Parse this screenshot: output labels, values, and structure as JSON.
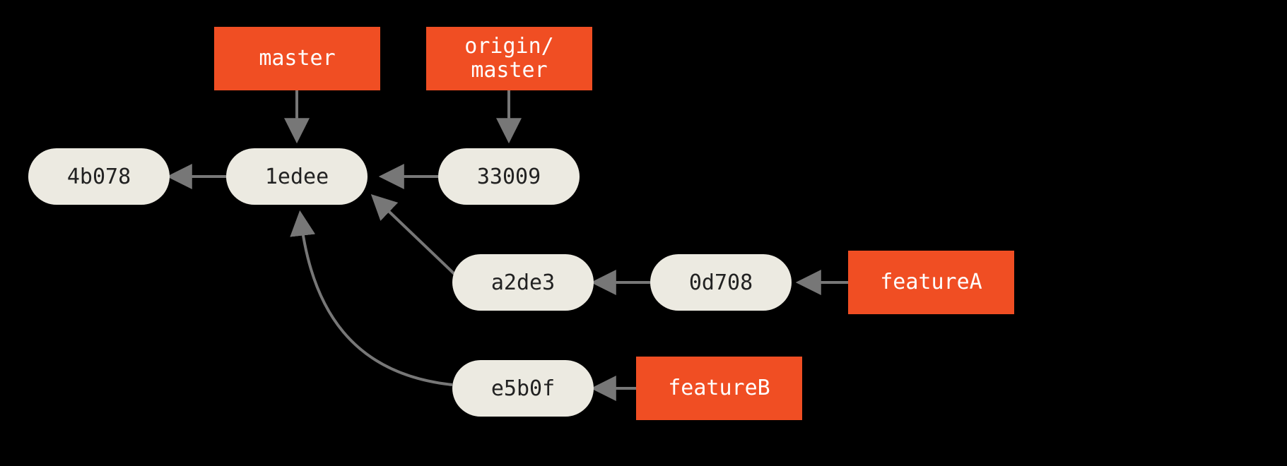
{
  "colors": {
    "bg": "#000000",
    "node_fill": "#ECEAE1",
    "node_text": "#222222",
    "branch_fill": "#F04E23",
    "branch_text": "#FFFFFF",
    "edge": "#777777"
  },
  "commits": {
    "c_4b078": "4b078",
    "c_1edee": "1edee",
    "c_33009": "33009",
    "c_a2de3": "a2de3",
    "c_0d708": "0d708",
    "c_e5b0f": "e5b0f"
  },
  "branches": {
    "master": "master",
    "origin_master": "origin/\nmaster",
    "featureA": "featureA",
    "featureB": "featureB"
  },
  "edges": [
    {
      "from": "c_1edee",
      "to": "c_4b078",
      "kind": "parent"
    },
    {
      "from": "c_33009",
      "to": "c_1edee",
      "kind": "parent"
    },
    {
      "from": "c_a2de3",
      "to": "c_1edee",
      "kind": "parent-diagonal"
    },
    {
      "from": "c_0d708",
      "to": "c_a2de3",
      "kind": "parent"
    },
    {
      "from": "c_e5b0f",
      "to": "c_1edee",
      "kind": "parent-curved"
    },
    {
      "from": "master",
      "to": "c_1edee",
      "kind": "branch-down"
    },
    {
      "from": "origin_master",
      "to": "c_33009",
      "kind": "branch-down"
    },
    {
      "from": "featureA",
      "to": "c_0d708",
      "kind": "branch-left"
    },
    {
      "from": "featureB",
      "to": "c_e5b0f",
      "kind": "branch-left"
    }
  ]
}
